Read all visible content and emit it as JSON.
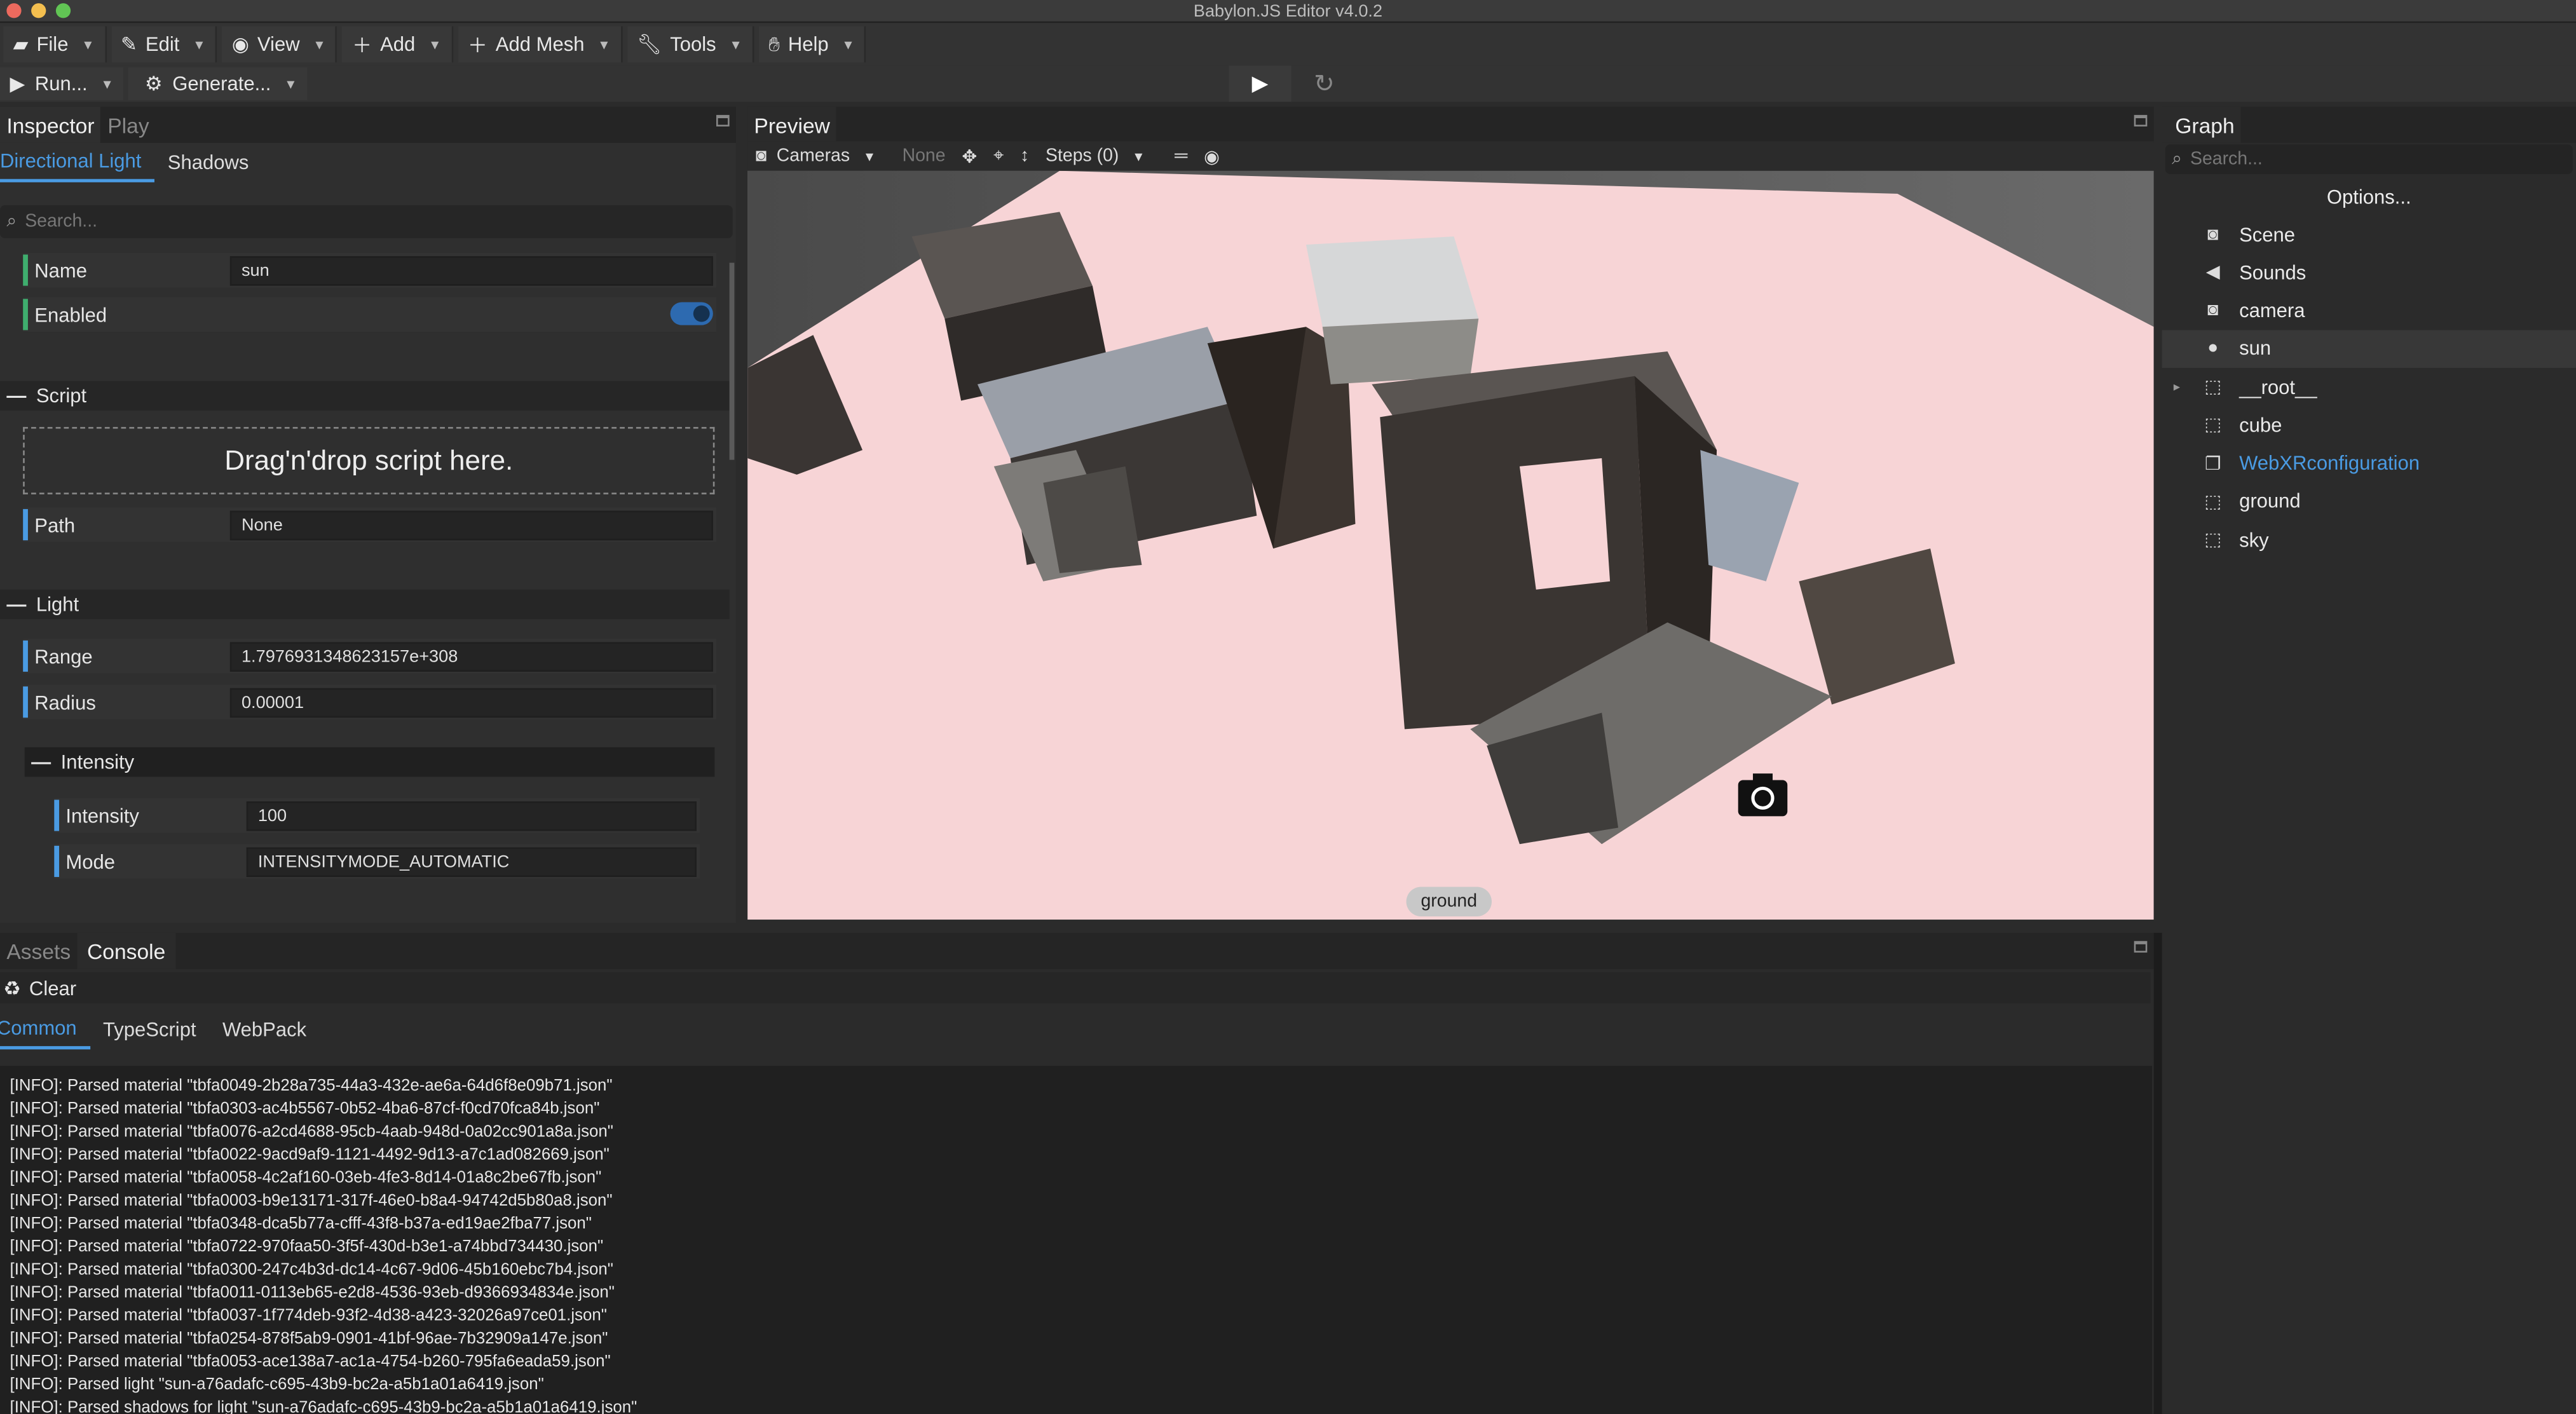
{
  "window": {
    "title": "Babylon.JS Editor v4.0.2"
  },
  "menubar": [
    {
      "label": "File",
      "icon": "folder-icon"
    },
    {
      "label": "Edit",
      "icon": "edit-icon"
    },
    {
      "label": "View",
      "icon": "eye-icon"
    },
    {
      "label": "Add",
      "icon": "plus-icon"
    },
    {
      "label": "Add Mesh",
      "icon": "plus-icon"
    },
    {
      "label": "Tools",
      "icon": "wrench-icon"
    },
    {
      "label": "Help",
      "icon": "help-icon"
    }
  ],
  "toolbar": {
    "run_label": "Run...",
    "generate_label": "Generate..."
  },
  "inspector": {
    "tabs": [
      "Inspector",
      "Play"
    ],
    "subtabs": [
      "Directional Light",
      "Shadows"
    ],
    "search_placeholder": "Search...",
    "name_label": "Name",
    "name_value": "sun",
    "enabled_label": "Enabled",
    "enabled_value": true,
    "script_section": "Script",
    "dropzone_text": "Drag'n'drop script here.",
    "path_label": "Path",
    "path_value": "None",
    "light_section": "Light",
    "range_label": "Range",
    "range_value": "1.7976931348623157e+308",
    "radius_label": "Radius",
    "radius_value": "0.00001",
    "intensity_section": "Intensity",
    "intensity_label": "Intensity",
    "intensity_value": "100",
    "mode_label": "Mode",
    "mode_value": "INTENSITYMODE_AUTOMATIC"
  },
  "preview": {
    "tab": "Preview",
    "cameras_label": "Cameras",
    "none_label": "None",
    "steps_label": "Steps (0)",
    "hover_label": "ground"
  },
  "graph": {
    "tab": "Graph",
    "search_placeholder": "Search...",
    "options_label": "Options...",
    "items": [
      {
        "label": "Scene",
        "icon": "scene-icon",
        "selected": false,
        "color": "#eaeaea"
      },
      {
        "label": "Sounds",
        "icon": "speaker-icon",
        "selected": false,
        "color": "#eaeaea"
      },
      {
        "label": "camera",
        "icon": "camera-icon",
        "selected": false,
        "color": "#eaeaea"
      },
      {
        "label": "sun",
        "icon": "bulb-icon",
        "selected": true,
        "color": "#eaeaea"
      },
      {
        "label": "__root__",
        "icon": "mesh-icon",
        "selected": false,
        "color": "#eaeaea"
      },
      {
        "label": "cube",
        "icon": "mesh-icon",
        "selected": false,
        "color": "#eaeaea"
      },
      {
        "label": "WebXRconfiguration",
        "icon": "copy-icon",
        "selected": false,
        "color": "#4a9be3"
      },
      {
        "label": "ground",
        "icon": "mesh-icon",
        "selected": false,
        "color": "#eaeaea"
      },
      {
        "label": "sky",
        "icon": "mesh-icon",
        "selected": false,
        "color": "#eaeaea"
      }
    ]
  },
  "bottom": {
    "tabs": [
      "Assets",
      "Console"
    ],
    "clear_label": "Clear",
    "subtabs": [
      "Common",
      "TypeScript",
      "WebPack"
    ],
    "log_lines": [
      "[INFO]: Parsed material \"tbfa0049-2b28a735-44a3-432e-ae6a-64d6f8e09b71.json\"",
      "[INFO]: Parsed material \"tbfa0303-ac4b5567-0b52-4ba6-87cf-f0cd70fca84b.json\"",
      "[INFO]: Parsed material \"tbfa0076-a2cd4688-95cb-4aab-948d-0a02cc901a8a.json\"",
      "[INFO]: Parsed material \"tbfa0022-9acd9af9-1121-4492-9d13-a7c1ad082669.json\"",
      "[INFO]: Parsed material \"tbfa0058-4c2af160-03eb-4fe3-8d14-01a8c2be67fb.json\"",
      "[INFO]: Parsed material \"tbfa0003-b9e13171-317f-46e0-b8a4-94742d5b80a8.json\"",
      "[INFO]: Parsed material \"tbfa0348-dca5b77a-cfff-43f8-b37a-ed19ae2fba77.json\"",
      "[INFO]: Parsed material \"tbfa0722-970faa50-3f5f-430d-b3e1-a74bbd734430.json\"",
      "[INFO]: Parsed material \"tbfa0300-247c4b3d-dc14-4c67-9d06-45b160ebc7b4.json\"",
      "[INFO]: Parsed material \"tbfa0011-0113eb65-e2d8-4536-93eb-d9366934834e.json\"",
      "[INFO]: Parsed material \"tbfa0037-1f774deb-93f2-4d38-a423-32026a97ce01.json\"",
      "[INFO]: Parsed material \"tbfa0254-878f5ab9-0901-41bf-96ae-7b32909a147e.json\"",
      "[INFO]: Parsed material \"tbfa0053-ace138a7-ac1a-4754-b260-795fa6eada59.json\"",
      "[INFO]: Parsed light \"sun-a76adafc-c695-43b9-bc2a-a5b1a01a6419.json\"",
      "[INFO]: Parsed shadows for light \"sun-a76adafc-c695-43b9-bc2a-a5b1a01a6419.json\""
    ]
  },
  "colors": {
    "accent": "#4a9be3",
    "ground": "#f7d4d6",
    "panel": "#2f2f2f",
    "name_bar": "#3fae6e",
    "field_bar": "#4a9be3"
  }
}
